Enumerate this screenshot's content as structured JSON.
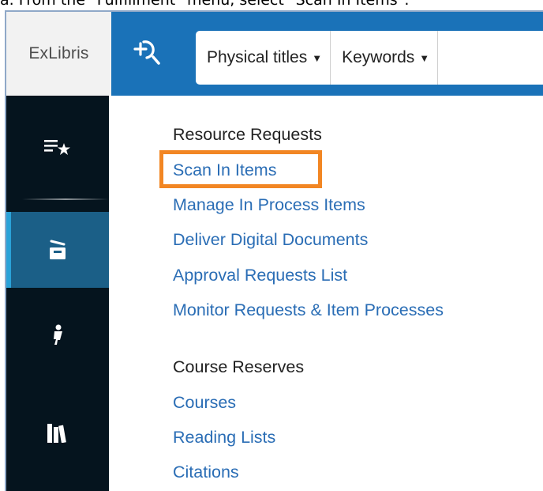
{
  "instruction": "a.   From the \"Fulfillment\" menu, select \"Scan In Items\".",
  "logo": {
    "text": "ExLibris"
  },
  "header": {
    "search_icon": "search-plus-icon",
    "scope_dropdown": "Physical titles",
    "field_dropdown": "Keywords"
  },
  "sidebar": {
    "items": [
      {
        "icon": "list-star-icon"
      },
      {
        "icon": "inbox-tray-icon",
        "active": true
      },
      {
        "icon": "key-person-icon"
      },
      {
        "icon": "books-icon"
      }
    ]
  },
  "menu": {
    "sections": [
      {
        "heading": "Resource Requests",
        "links": [
          "Scan In Items",
          "Manage In Process Items",
          "Deliver Digital Documents",
          "Approval Requests List",
          "Monitor Requests & Item Processes"
        ]
      },
      {
        "heading": "Course Reserves",
        "links": [
          "Courses",
          "Reading Lists",
          "Citations"
        ]
      }
    ],
    "highlighted_link": "Scan In Items"
  },
  "colors": {
    "topbar": "#1a72b8",
    "sidebar": "#05141e",
    "active_item": "#1b5f87",
    "link": "#2a6db5",
    "highlight": "#f28623"
  }
}
